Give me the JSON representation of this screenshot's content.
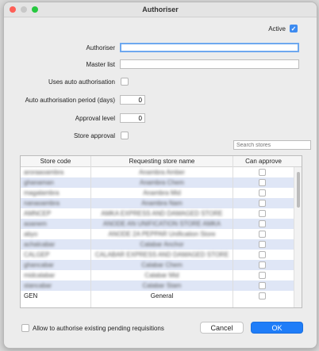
{
  "window": {
    "title": "Authoriser"
  },
  "form": {
    "active_label": "Active",
    "active_checked": true,
    "authoriser_label": "Authoriser",
    "authoriser_value": "",
    "master_list_label": "Master list",
    "master_list_value": "",
    "uses_auto_label": "Uses auto authorisation",
    "uses_auto_checked": false,
    "auto_period_label": "Auto authorisation period (days)",
    "auto_period_value": "0",
    "approval_level_label": "Approval level",
    "approval_level_value": "0",
    "store_approval_label": "Store approval",
    "store_approval_checked": false,
    "search_placeholder": "Search stores"
  },
  "table": {
    "headers": {
      "code": "Store code",
      "name": "Requesting store name",
      "approve": "Can approve"
    },
    "rows": [
      {
        "code": "aroraaoambra",
        "name": "Anambra Amber",
        "approve": false,
        "redacted": true
      },
      {
        "code": "ghanaman",
        "name": "Anambra Chem",
        "approve": false,
        "redacted": true
      },
      {
        "code": "magalambra",
        "name": "Anambra Mid",
        "approve": false,
        "redacted": true
      },
      {
        "code": "nanaoambra",
        "name": "Anambra Nam",
        "approve": false,
        "redacted": true
      },
      {
        "code": "AMNCEP",
        "name": "AMKA EXPRESS AND DAMAGED STORE",
        "approve": false,
        "redacted": true
      },
      {
        "code": "aoanem",
        "name": "ANODE AN UNIFICATION STORE AMKA",
        "approve": false,
        "redacted": true
      },
      {
        "code": "abyo",
        "name": "ANODE 2A PEPPAR Unification Store",
        "approve": false,
        "redacted": true
      },
      {
        "code": "achalcabar",
        "name": "Calabar Anchor",
        "approve": false,
        "redacted": true
      },
      {
        "code": "CALGEP",
        "name": "CALABAR EXPRESS AND DAMAGED STORE",
        "approve": false,
        "redacted": true
      },
      {
        "code": "ghancabar",
        "name": "Calabar Chem",
        "approve": false,
        "redacted": true
      },
      {
        "code": "midcalabar",
        "name": "Calabar Mid",
        "approve": false,
        "redacted": true
      },
      {
        "code": "stancabar",
        "name": "Calabar Stam",
        "approve": false,
        "redacted": true
      },
      {
        "code": "GEN",
        "name": "General",
        "approve": false,
        "redacted": false
      }
    ]
  },
  "footer": {
    "allow_pending_label": "Allow to authorise existing pending requisitions",
    "allow_pending_checked": false,
    "cancel_label": "Cancel",
    "ok_label": "OK"
  },
  "colors": {
    "accent": "#1f7df8",
    "row_alt": "#dfe6f6",
    "focus": "#6ea8ef"
  }
}
